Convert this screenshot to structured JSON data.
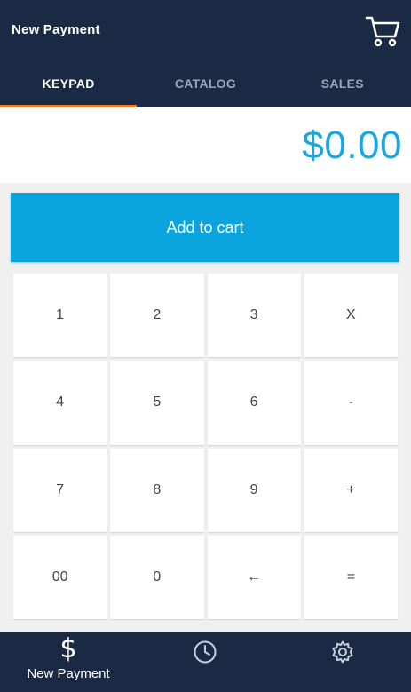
{
  "header": {
    "title": "New Payment",
    "cart_icon": "cart-icon"
  },
  "tabs": [
    {
      "label": "KEYPAD",
      "active": true
    },
    {
      "label": "CATALOG",
      "active": false
    },
    {
      "label": "SALES",
      "active": false
    }
  ],
  "amount": "$0.00",
  "add_to_cart_label": "Add to cart",
  "keypad": {
    "keys": [
      {
        "label": "1",
        "name": "key-1"
      },
      {
        "label": "2",
        "name": "key-2"
      },
      {
        "label": "3",
        "name": "key-3"
      },
      {
        "label": "X",
        "name": "key-multiply"
      },
      {
        "label": "4",
        "name": "key-4"
      },
      {
        "label": "5",
        "name": "key-5"
      },
      {
        "label": "6",
        "name": "key-6"
      },
      {
        "label": "-",
        "name": "key-minus"
      },
      {
        "label": "7",
        "name": "key-7"
      },
      {
        "label": "8",
        "name": "key-8"
      },
      {
        "label": "9",
        "name": "key-9"
      },
      {
        "label": "+",
        "name": "key-plus"
      },
      {
        "label": "00",
        "name": "key-00"
      },
      {
        "label": "0",
        "name": "key-0"
      },
      {
        "label": "←",
        "name": "key-backspace"
      },
      {
        "label": "=",
        "name": "key-equals"
      }
    ]
  },
  "bottom_nav": {
    "new_payment": {
      "label": "New Payment",
      "glyph": "$",
      "icon": "dollar-icon"
    },
    "history": {
      "icon": "clock-icon"
    },
    "settings": {
      "icon": "gear-icon"
    }
  },
  "colors": {
    "header_bg": "#1b2a44",
    "active_tab_indicator": "#f47b20",
    "amount_text": "#1aa6de",
    "button_bg": "#0aa4df"
  }
}
